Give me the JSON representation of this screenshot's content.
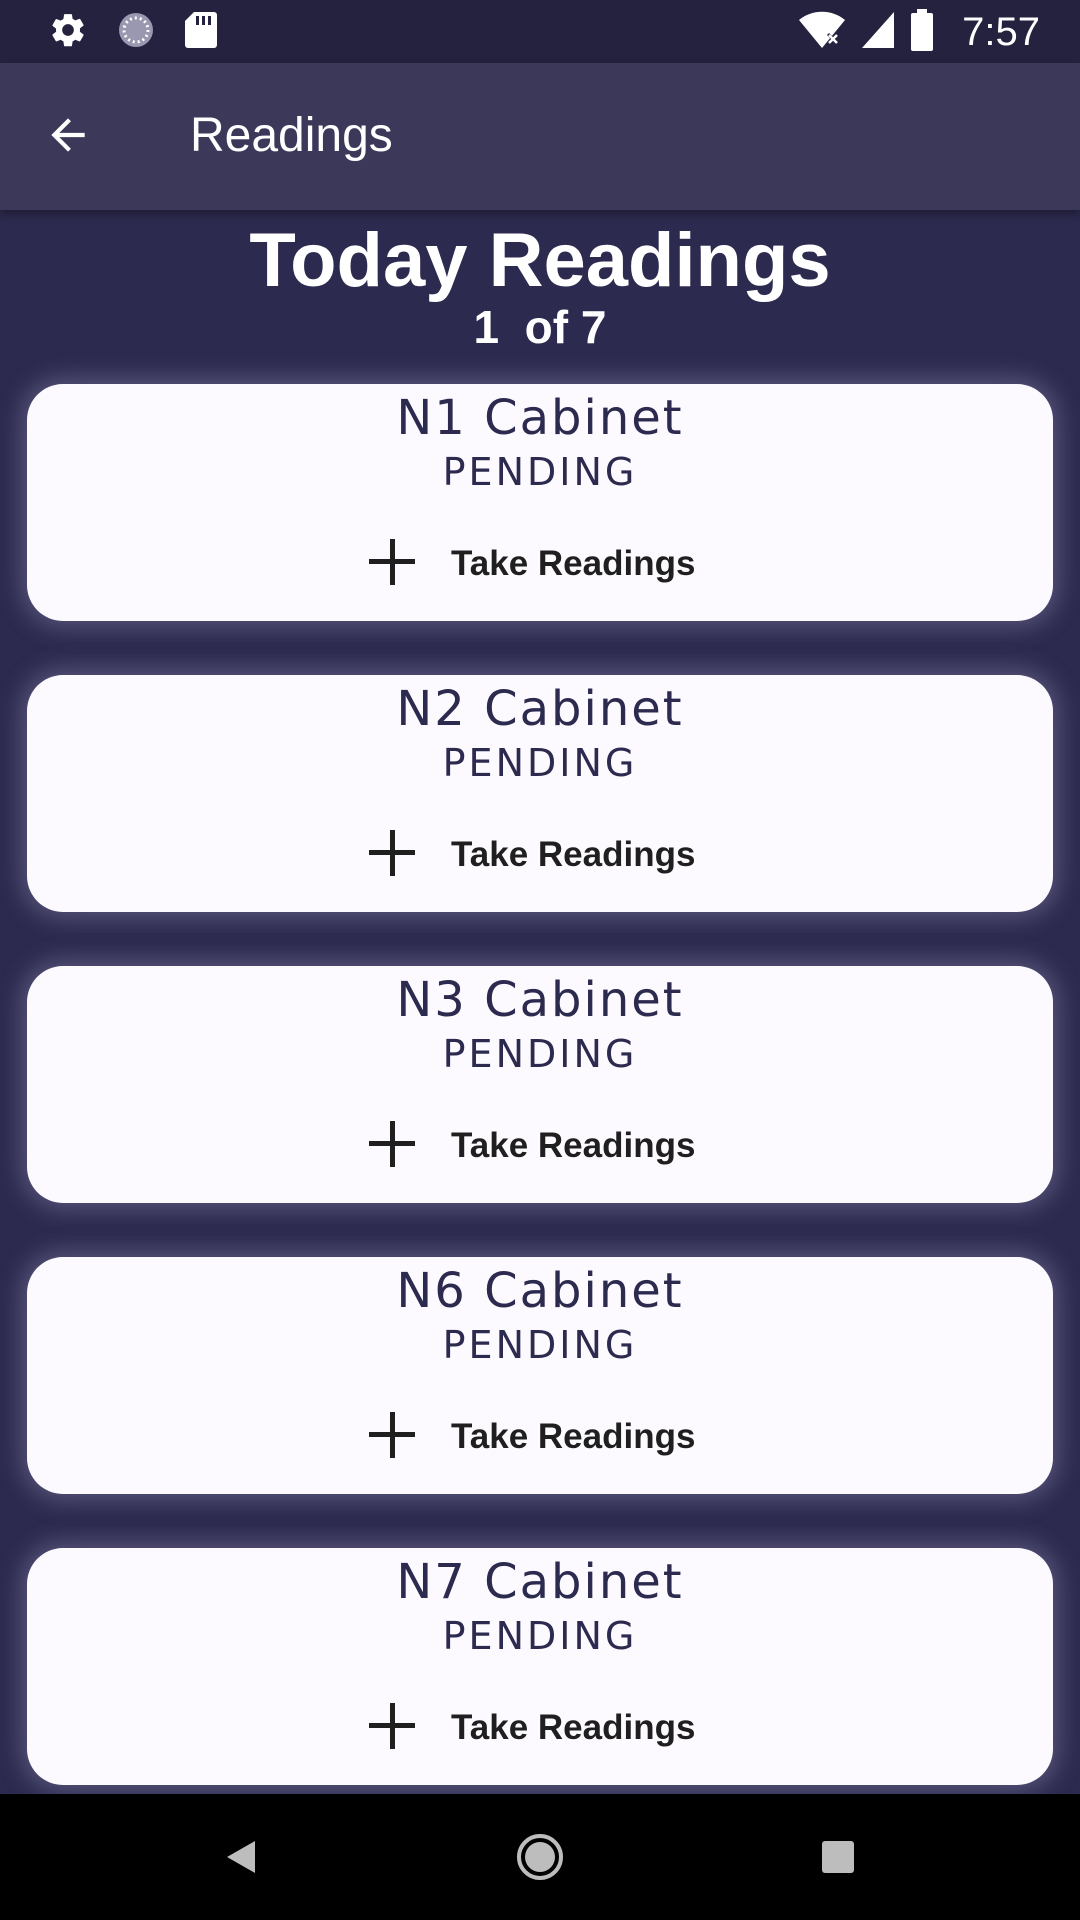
{
  "status_bar": {
    "time": "7:57",
    "left_icons": [
      "settings-icon",
      "sync-icon",
      "sd-card-icon"
    ],
    "right_icons": [
      "wifi-icon",
      "signal-icon",
      "battery-icon"
    ]
  },
  "app_bar": {
    "title": "Readings",
    "back_icon": "arrow-left-icon"
  },
  "header": {
    "title": "Today Readings",
    "counter": "1  of 7"
  },
  "cards": [
    {
      "name": "N1 Cabinet",
      "status": "PENDING",
      "action": "Take Readings"
    },
    {
      "name": "N2 Cabinet",
      "status": "PENDING",
      "action": "Take Readings"
    },
    {
      "name": "N3 Cabinet",
      "status": "PENDING",
      "action": "Take Readings"
    },
    {
      "name": "N6 Cabinet",
      "status": "PENDING",
      "action": "Take Readings"
    },
    {
      "name": "N7 Cabinet",
      "status": "PENDING",
      "action": "Take Readings"
    }
  ],
  "nav_bar": {
    "icons": [
      "back-triangle-icon",
      "home-circle-icon",
      "recents-square-icon"
    ]
  },
  "colors": {
    "background": "#2c2a4e",
    "app_bar": "#3b3859",
    "card": "#fdfaff",
    "card_text": "#2c2a4e"
  }
}
